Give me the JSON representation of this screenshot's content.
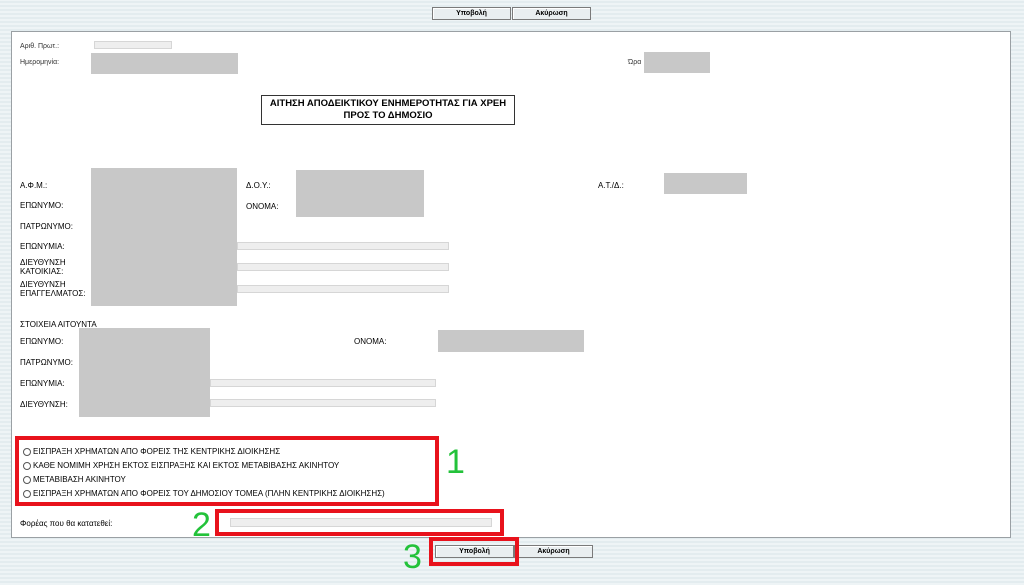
{
  "toolbar": {
    "submit_label": "Υποβολή",
    "cancel_label": "Ακύρωση"
  },
  "header": {
    "protocol_label": "Αριθ. Πρωτ.:",
    "date_label": "Ημερομηνία:",
    "time_label": "Ώρα"
  },
  "form_title": "ΑΙΤΗΣΗ ΑΠΟΔΕΙΚΤΙΚΟΥ ΕΝΗΜΕΡΟΤΗΤΑΣ ΓΙΑ ΧΡΕΗ ΠΡΟΣ ΤΟ ΔΗΜΟΣΙΟ",
  "taxpayer": {
    "afm_label": "Α.Φ.Μ.:",
    "doy_label": "Δ.Ο.Υ.:",
    "atd_label": "Α.Τ./Δ.:",
    "surname_label": "ΕΠΩΝΥΜΟ:",
    "name_label": "ΟΝΟΜΑ:",
    "father_label": "ΠΑΤΡΩΝΥΜΟ:",
    "business_name_label": "ΕΠΩΝΥΜΙΑ:",
    "home_address_label": "ΔΙΕΥΘΥΝΣΗ ΚΑΤΟΙΚΙΑΣ:",
    "work_address_label": "ΔΙΕΥΘΥΝΣΗ ΕΠΑΓΓΕΛΜΑΤΟΣ:"
  },
  "applicant": {
    "section_label": "ΣΤΟΙΧΕΙΑ ΑΙΤΟΥΝΤΑ",
    "surname_label": "ΕΠΩΝΥΜΟ:",
    "name_label": "ΟΝΟΜΑ:",
    "father_label": "ΠΑΤΡΩΝΥΜΟ:",
    "business_name_label": "ΕΠΩΝΥΜΙΑ:",
    "address_label": "ΔΙΕΥΘΥΝΣΗ:"
  },
  "purpose_options": [
    "ΕΙΣΠΡΑΞΗ ΧΡΗΜΑΤΩΝ ΑΠΟ ΦΟΡΕΙΣ ΤΗΣ ΚΕΝΤΡΙΚΗΣ ΔΙΟΙΚΗΣΗΣ",
    "ΚΑΘΕ ΝΟΜΙΜΗ ΧΡΗΣΗ ΕΚΤΟΣ ΕΙΣΠΡΑΞΗΣ ΚΑΙ ΕΚΤΟΣ ΜΕΤΑΒΙΒΑΣΗΣ ΑΚΙΝΗΤΟΥ",
    "ΜΕΤΑΒΙΒΑΣΗ ΑΚΙΝΗΤΟΥ",
    "ΕΙΣΠΡΑΞΗ ΧΡΗΜΑΤΩΝ ΑΠΟ ΦΟΡΕΙΣ ΤΟΥ ΔΗΜΟΣΙΟΥ ΤΟΜΕΑ (ΠΛΗΝ ΚΕΝΤΡΙΚΗΣ ΔΙΟΙΚΗΣΗΣ)"
  ],
  "recipient": {
    "label": "Φορέας που θα κατατεθεί:",
    "value": ""
  },
  "annotations": [
    "1",
    "2",
    "3"
  ],
  "colors": {
    "annotation_box": "#e8121c",
    "annotation_number": "#23c23a"
  }
}
